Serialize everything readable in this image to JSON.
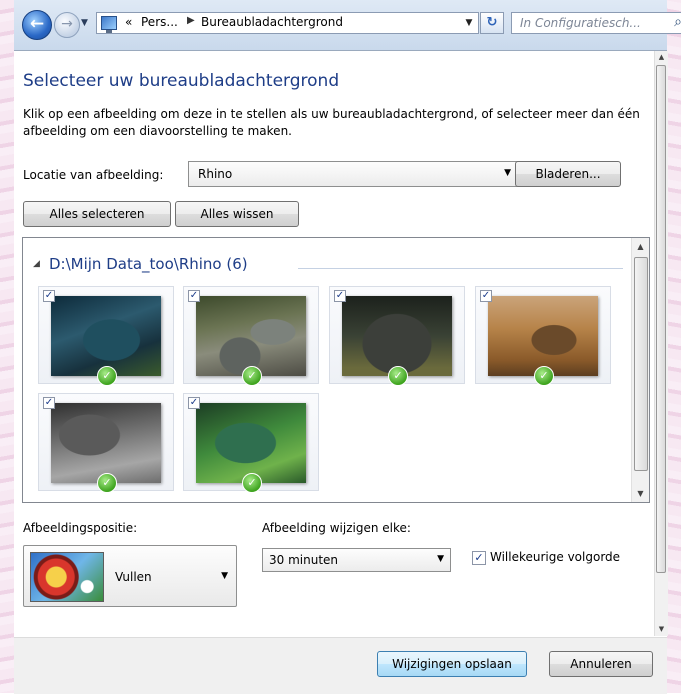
{
  "nav": {
    "back_icon": "back-arrow-icon",
    "forward_icon": "forward-arrow-icon",
    "breadcrumb_overflow": "«",
    "breadcrumbs": [
      "Pers...",
      "Bureaubladachtergrond"
    ],
    "search_placeholder": "In Configuratiesch..."
  },
  "page": {
    "title": "Selecteer uw bureaubladachtergrond",
    "description": "Klik op een afbeelding om deze in te stellen als uw bureaubladachtergrond, of selecteer meer dan één afbeelding om een diavoorstelling te maken."
  },
  "location": {
    "label": "Locatie van afbeelding:",
    "value": "Rhino",
    "browse_label": "Bladeren..."
  },
  "selection": {
    "select_all_label": "Alles selecteren",
    "clear_all_label": "Alles wissen"
  },
  "gallery": {
    "group_title": "D:\\Mijn Data_too\\Rhino (6)",
    "items": [
      {
        "icon": "rhino-photo-1",
        "checked": true
      },
      {
        "icon": "rhino-photo-2",
        "checked": true
      },
      {
        "icon": "rhino-photo-3",
        "checked": true
      },
      {
        "icon": "rhino-photo-4",
        "checked": true
      },
      {
        "icon": "rhino-photo-5",
        "checked": true
      },
      {
        "icon": "rhino-photo-6",
        "checked": true
      }
    ]
  },
  "position": {
    "label": "Afbeeldingspositie:",
    "value": "Vullen"
  },
  "interval": {
    "label": "Afbeelding wijzigen elke:",
    "value": "30 minuten"
  },
  "shuffle": {
    "label": "Willekeurige volgorde",
    "checked": true
  },
  "footer": {
    "save_label": "Wijzigingen opslaan",
    "cancel_label": "Annuleren"
  }
}
